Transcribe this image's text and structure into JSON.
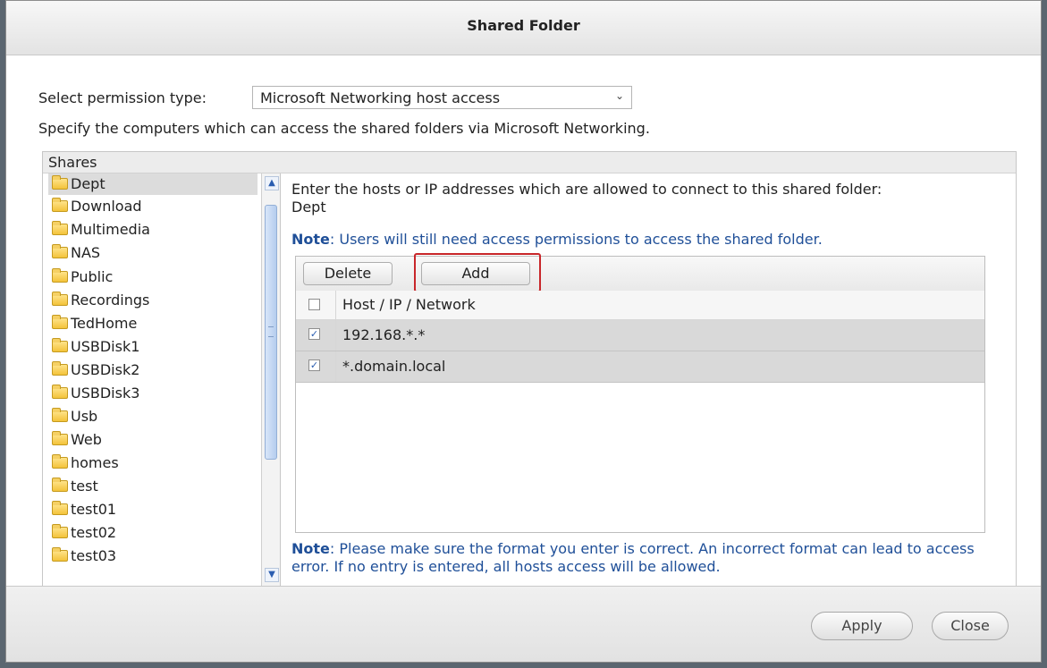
{
  "dialog": {
    "title": "Shared Folder"
  },
  "permission": {
    "label": "Select permission type:",
    "selected": "Microsoft Networking host access",
    "description": "Specify the computers which can access the shared folders via Microsoft Networking."
  },
  "shares": {
    "header": "Shares",
    "selected": "Dept",
    "items": [
      "Dept",
      "Download",
      "Multimedia",
      "NAS",
      "Public",
      "Recordings",
      "TedHome",
      "USBDisk1",
      "USBDisk2",
      "USBDisk3",
      "Usb",
      "Web",
      "homes",
      "test",
      "test01",
      "test02",
      "test03"
    ]
  },
  "access": {
    "instruction": "Enter the hosts or IP addresses which are allowed to connect to this shared folder:",
    "folder": "Dept",
    "note_label": "Note",
    "note_text": ": Users will still need access permissions to access the shared folder.",
    "toolbar": {
      "delete_label": "Delete",
      "add_label": "Add"
    },
    "column_header": "Host / IP / Network",
    "rows": [
      {
        "value": "192.168.*.*",
        "checked": true
      },
      {
        "value": "*.domain.local",
        "checked": true
      }
    ],
    "footer_note_label": "Note",
    "footer_note_text": ": Please make sure the format you enter is correct. An incorrect format can lead to access error. If no entry is entered, all hosts access will be allowed."
  },
  "footer": {
    "apply_label": "Apply",
    "close_label": "Close"
  }
}
